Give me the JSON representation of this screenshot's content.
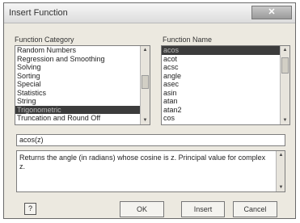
{
  "title": "Insert Function",
  "close_label": "✕",
  "category_label": "Function Category",
  "name_label": "Function Name",
  "categories": [
    {
      "label": "Random Numbers",
      "selected": false
    },
    {
      "label": "Regression and Smoothing",
      "selected": false
    },
    {
      "label": "Solving",
      "selected": false
    },
    {
      "label": "Sorting",
      "selected": false
    },
    {
      "label": "Special",
      "selected": false
    },
    {
      "label": "Statistics",
      "selected": false
    },
    {
      "label": "String",
      "selected": false
    },
    {
      "label": "Trigonometric",
      "selected": true
    },
    {
      "label": "Truncation and Round Off",
      "selected": false
    }
  ],
  "functions": [
    {
      "label": "acos",
      "selected": true
    },
    {
      "label": "acot",
      "selected": false
    },
    {
      "label": "acsc",
      "selected": false
    },
    {
      "label": "angle",
      "selected": false
    },
    {
      "label": "asec",
      "selected": false
    },
    {
      "label": "asin",
      "selected": false
    },
    {
      "label": "atan",
      "selected": false
    },
    {
      "label": "atan2",
      "selected": false
    },
    {
      "label": "cos",
      "selected": false
    }
  ],
  "syntax": "acos(z)",
  "description": "Returns the angle (in radians) whose cosine is z. Principal value for complex z.",
  "buttons": {
    "help": "?",
    "ok": "OK",
    "insert": "Insert",
    "cancel": "Cancel"
  }
}
